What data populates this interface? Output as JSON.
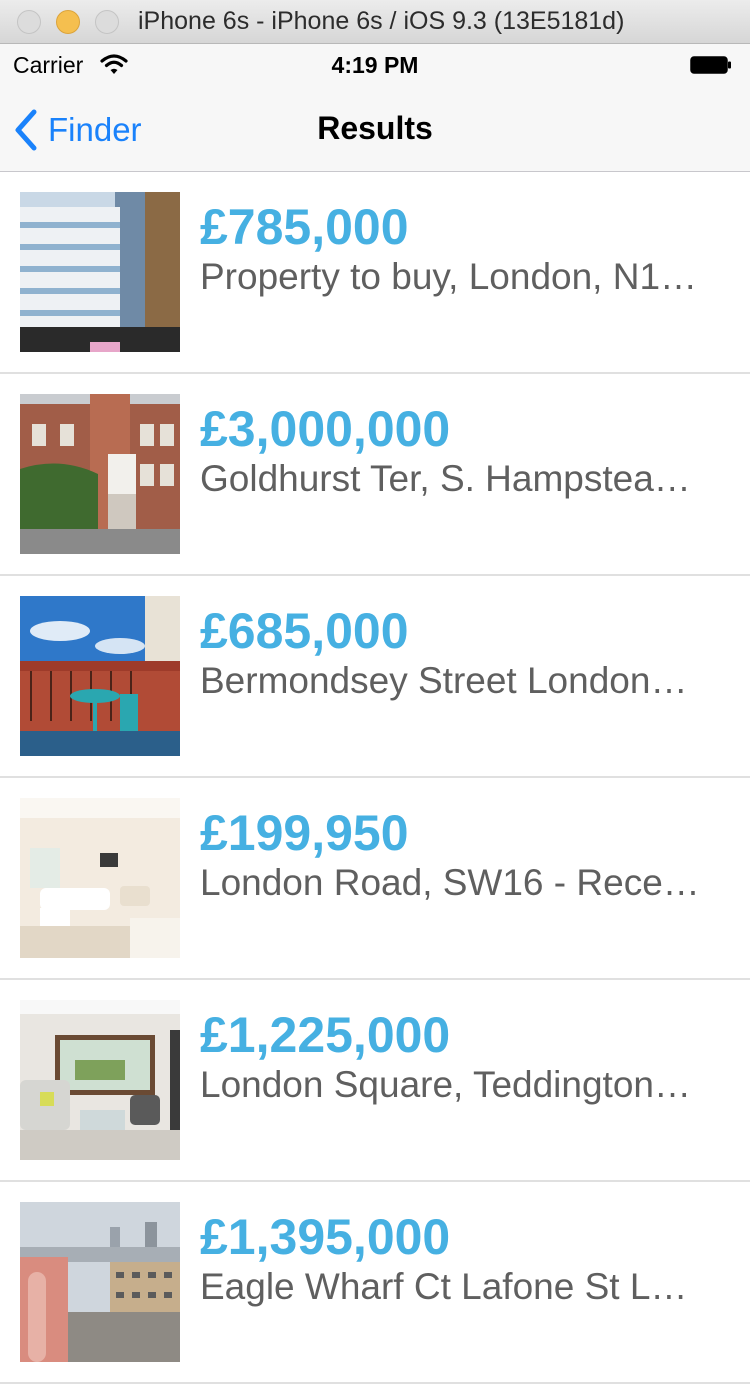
{
  "window": {
    "title": "iPhone 6s - iPhone 6s / iOS 9.3 (13E5181d)"
  },
  "status": {
    "carrier": "Carrier",
    "time": "4:19 PM"
  },
  "nav": {
    "back_label": "Finder",
    "title": "Results"
  },
  "listings": [
    {
      "price": "£785,000",
      "title": "Property to buy, London, N1…"
    },
    {
      "price": "£3,000,000",
      "title": "Goldhurst Ter, S. Hampstea…"
    },
    {
      "price": "£685,000",
      "title": "Bermondsey Street London…"
    },
    {
      "price": "£199,950",
      "title": "London Road, SW16 - Rece…"
    },
    {
      "price": "£1,225,000",
      "title": "London Square, Teddington…"
    },
    {
      "price": "£1,395,000",
      "title": "Eagle Wharf Ct Lafone St L…"
    }
  ],
  "colors": {
    "accent": "#1a82fb",
    "price": "#46b0e2",
    "subtitle": "#5f5f5f"
  }
}
